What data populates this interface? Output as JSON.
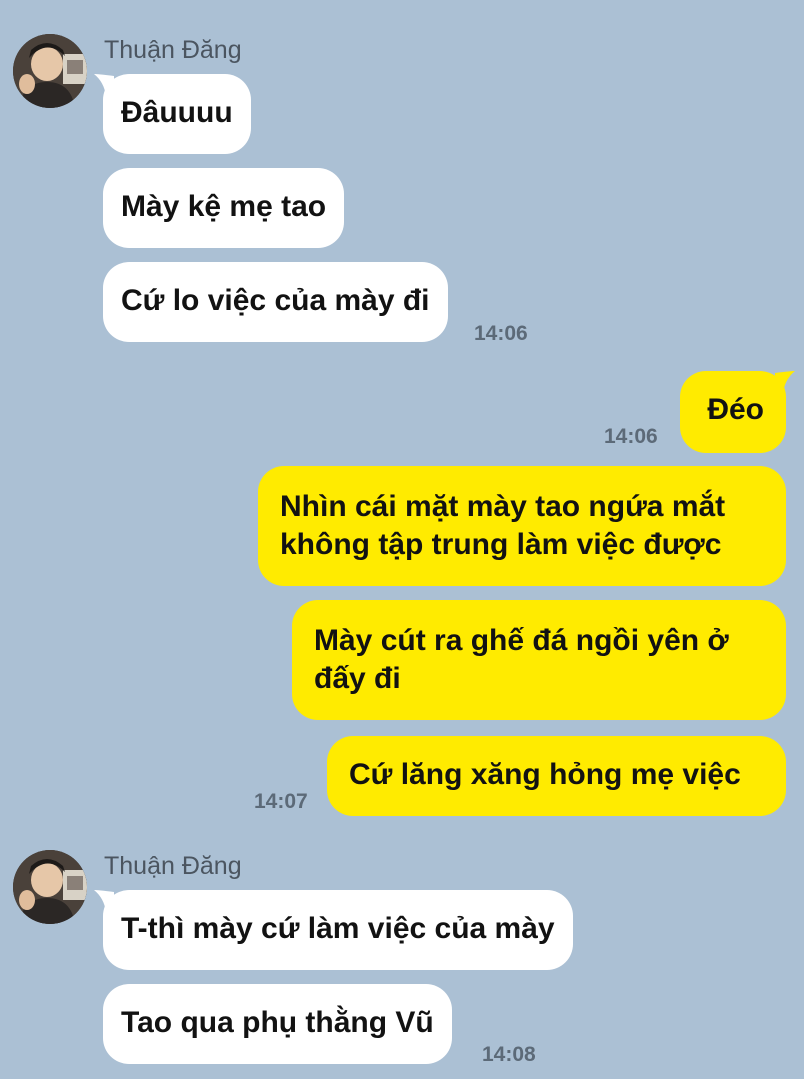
{
  "colors": {
    "background": "#abc0d4",
    "incoming_bubble": "#ffffff",
    "outgoing_bubble": "#ffeb00"
  },
  "group1": {
    "sender": "Thuận Đăng",
    "messages": [
      "Đâuuuu",
      "Mày kệ mẹ tao",
      "Cứ lo việc của mày đi"
    ],
    "time": "14:06"
  },
  "group2": {
    "messages": [
      "Đéo"
    ],
    "time": "14:06"
  },
  "group3": {
    "messages": [
      "Nhìn cái mặt mày tao ngứa mắt không tập trung làm việc được",
      "Mày cút ra ghế đá ngồi yên ở đấy đi",
      "Cứ lăng xăng hỏng mẹ việc"
    ],
    "time": "14:07"
  },
  "group4": {
    "sender": "Thuận Đăng",
    "messages": [
      "T-thì mày cứ làm việc của mày",
      "Tao qua phụ thằng Vũ"
    ],
    "time": "14:08"
  }
}
